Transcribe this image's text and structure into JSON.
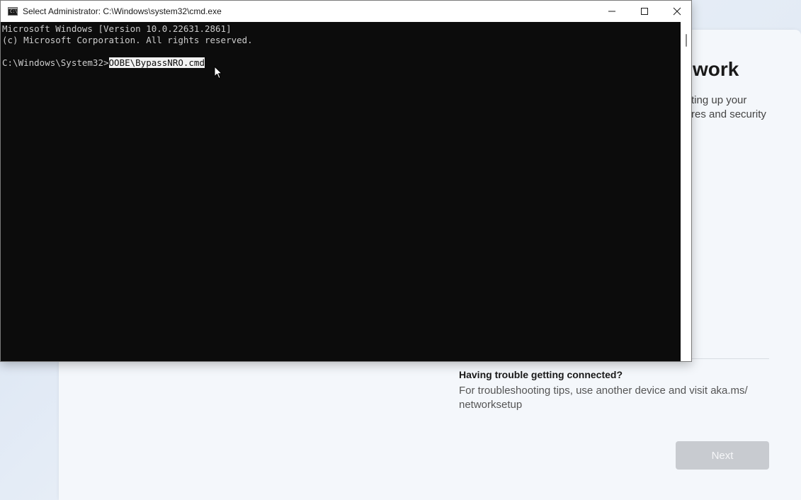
{
  "oobe": {
    "title_fragment": "work",
    "description_fragment": "ting up your\nres and security",
    "trouble_title": "Having trouble getting connected?",
    "trouble_text": "For troubleshooting tips, use another device and visit aka.ms/\nnetworksetup",
    "next_label": "Next"
  },
  "cmd": {
    "window_title": "Select Administrator: C:\\Windows\\system32\\cmd.exe",
    "icon_text": "C:\\",
    "lines": [
      "Microsoft Windows [Version 10.0.22631.2861]",
      "(c) Microsoft Corporation. All rights reserved."
    ],
    "prompt": "C:\\Windows\\System32>",
    "selected_command": "OOBE\\BypassNRO.cmd"
  },
  "icons": {
    "minimize": "minimize-icon",
    "maximize": "maximize-icon",
    "close": "close-icon",
    "cursor": "mouse-pointer-icon"
  }
}
